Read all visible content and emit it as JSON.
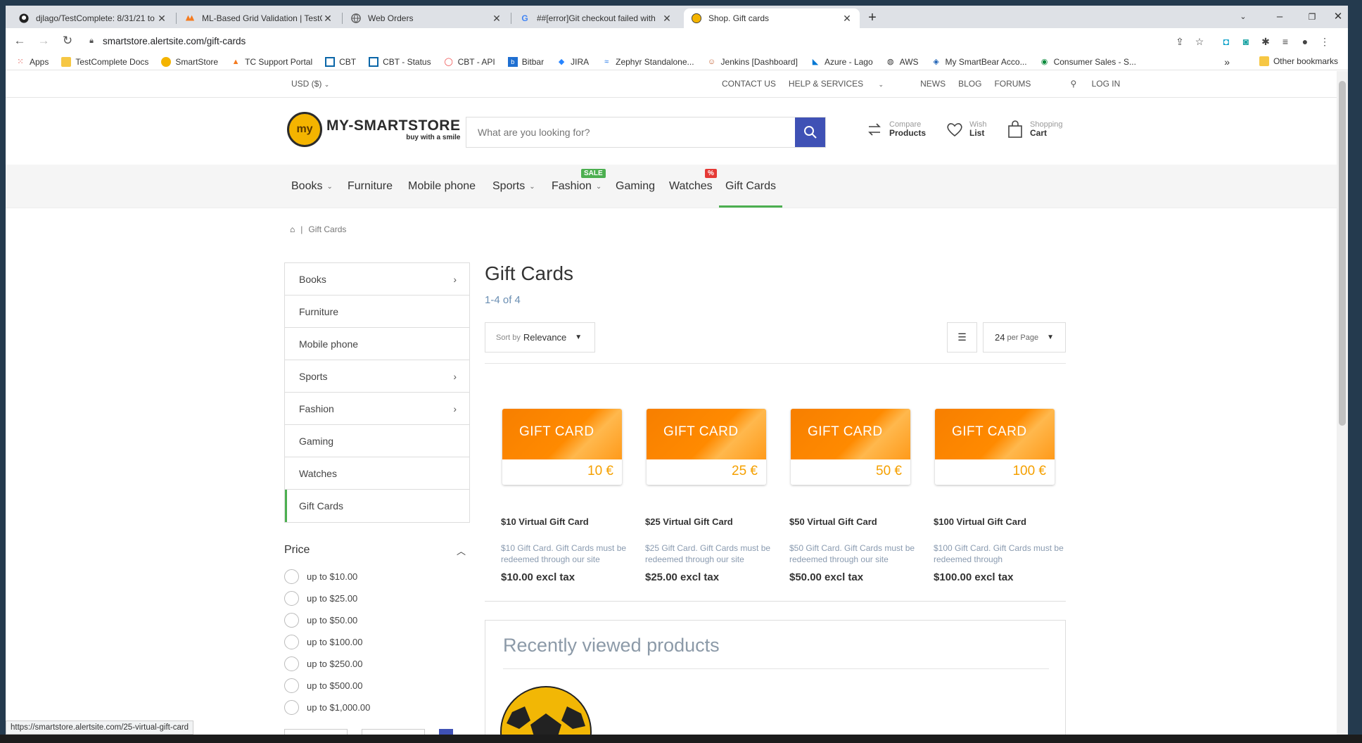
{
  "browser": {
    "tabs": [
      {
        "title": "djlago/TestComplete: 8/31/21 to",
        "icon": "github-icon"
      },
      {
        "title": "ML-Based Grid Validation | TestC",
        "icon": "smartbear-icon"
      },
      {
        "title": "Web Orders",
        "icon": "globe-icon"
      },
      {
        "title": "##[error]Git checkout failed with",
        "icon": "google-icon"
      },
      {
        "title": "Shop. Gift cards",
        "icon": "smartstore-icon"
      }
    ],
    "url": "smartstore.alertsite.com/gift-cards",
    "bookmarks": [
      "Apps",
      "TestComplete Docs",
      "SmartStore",
      "TC Support Portal",
      "CBT",
      "CBT - Status",
      "CBT - API",
      "Bitbar",
      "JIRA",
      "Zephyr Standalone...",
      "Jenkins [Dashboard]",
      "Azure - Lago",
      "AWS",
      "My SmartBear Acco...",
      "Consumer Sales - S..."
    ],
    "bookmarks_more": "»",
    "other_bookmarks": "Other bookmarks",
    "status_url": "https://smartstore.alertsite.com/25-virtual-gift-card"
  },
  "topbar": {
    "currency": "USD ($)",
    "contact": "CONTACT US",
    "help": "HELP & SERVICES",
    "news": "NEWS",
    "blog": "BLOG",
    "forums": "FORUMS",
    "login": "LOG IN"
  },
  "header": {
    "logo_title": "MY-SMARTSTORE",
    "logo_tagline": "buy with a smile",
    "logo_mark": "my",
    "search_placeholder": "What are you looking for?",
    "compare_l1": "Compare",
    "compare_l2": "Products",
    "wish_l1": "Wish",
    "wish_l2": "List",
    "cart_l1": "Shopping",
    "cart_l2": "Cart"
  },
  "categories": [
    {
      "label": "Books",
      "dropdown": true
    },
    {
      "label": "Furniture",
      "dropdown": false
    },
    {
      "label": "Mobile phone",
      "dropdown": false
    },
    {
      "label": "Sports",
      "dropdown": true
    },
    {
      "label": "Fashion",
      "dropdown": true
    },
    {
      "label": "Gaming",
      "dropdown": false
    },
    {
      "label": "Watches",
      "dropdown": false
    },
    {
      "label": "Gift Cards",
      "dropdown": false
    }
  ],
  "badges": {
    "sale": "SALE",
    "percent": "%"
  },
  "breadcrumb": {
    "sep": "|",
    "current": "Gift Cards"
  },
  "sidebar": [
    "Books",
    "Furniture",
    "Mobile phone",
    "Sports",
    "Fashion",
    "Gaming",
    "Watches",
    "Gift Cards"
  ],
  "price_filter": {
    "title": "Price",
    "options": [
      "up to $10.00",
      "up to $25.00",
      "up to $50.00",
      "up to $100.00",
      "up to $250.00",
      "up to $500.00",
      "up to $1,000.00"
    ]
  },
  "main": {
    "title": "Gift Cards",
    "count": "1-4 of 4",
    "sort_prefix": "Sort by",
    "sort_value": "Relevance",
    "per_page_value": "24",
    "per_page_suffix": "per Page"
  },
  "products": [
    {
      "card_text": "GIFT CARD",
      "amount": "10 €",
      "name": "$10 Virtual Gift Card",
      "desc": "$10 Gift Card. Gift Cards must be redeemed through our site",
      "price": "$10.00 excl tax"
    },
    {
      "card_text": "GIFT CARD",
      "amount": "25 €",
      "name": "$25 Virtual Gift Card",
      "desc": "$25 Gift Card. Gift Cards must be redeemed through our site",
      "price": "$25.00 excl tax"
    },
    {
      "card_text": "GIFT CARD",
      "amount": "50 €",
      "name": "$50 Virtual Gift Card",
      "desc": "$50 Gift Card. Gift Cards must be redeemed through our site",
      "price": "$50.00 excl tax"
    },
    {
      "card_text": "GIFT CARD",
      "amount": "100 €",
      "name": "$100 Virtual Gift Card",
      "desc": "$100 Gift Card. Gift Cards must be redeemed through",
      "price": "$100.00 excl tax"
    }
  ],
  "recent": {
    "title": "Recently viewed products"
  }
}
